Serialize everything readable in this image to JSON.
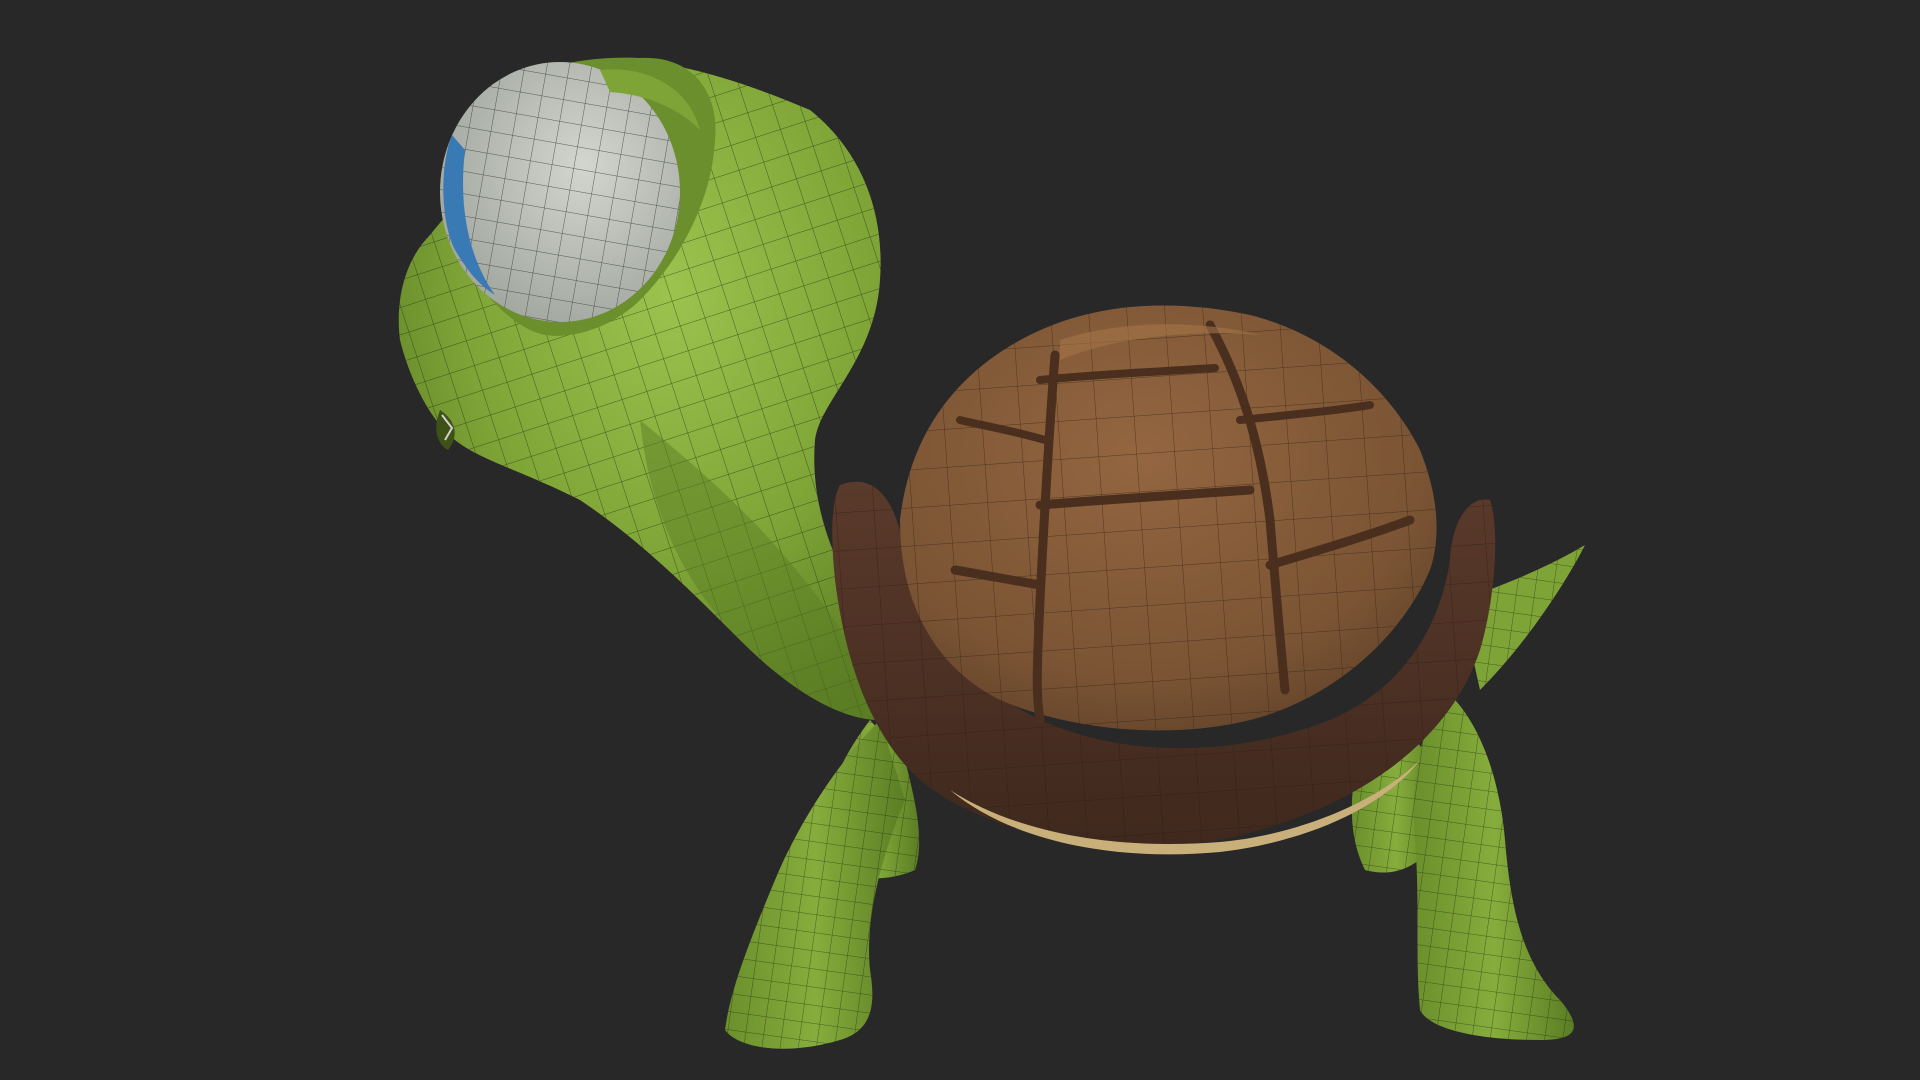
{
  "viewport": {
    "background": "#282828",
    "subject": "turtle-wireframe-model"
  },
  "colors": {
    "skin": "#7ea437",
    "skin_shadow": "#5b7d24",
    "skin_light": "#9cc34e",
    "shell_top": "#7a5434",
    "shell_top_light": "#946640",
    "shell_rim": "#4e3226",
    "shell_rim_dark": "#3a241b",
    "eye_white": "#c3c6c0",
    "eye_pupil": "#3a7ab4",
    "belly_trim": "#c9b07a",
    "wire": "#1e2410"
  }
}
